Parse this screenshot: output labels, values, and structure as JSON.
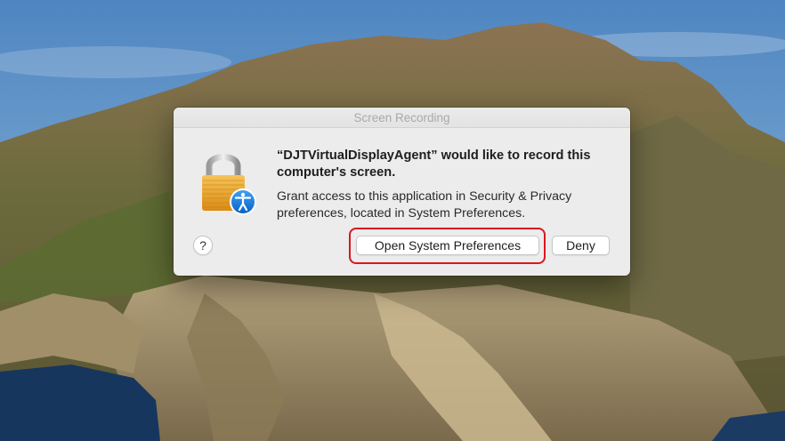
{
  "wallpaper": {
    "name": "macOS Catalina",
    "colors": {
      "sky": "#5d90c6",
      "ocean": "#1d3f6c",
      "rock": "#8a7f62",
      "vegetation": "#4e5c2c"
    }
  },
  "dialog": {
    "title": "Screen Recording",
    "icon": "padlock-accessibility-icon",
    "message_title": "“DJTVirtualDisplayAgent” would like to record this computer's screen.",
    "message_body": "Grant access to this application in Security & Privacy preferences, located in System Preferences.",
    "help_label": "?",
    "buttons": {
      "open_preferences": "Open System Preferences",
      "deny": "Deny"
    },
    "highlight_color": "#d9171f"
  }
}
